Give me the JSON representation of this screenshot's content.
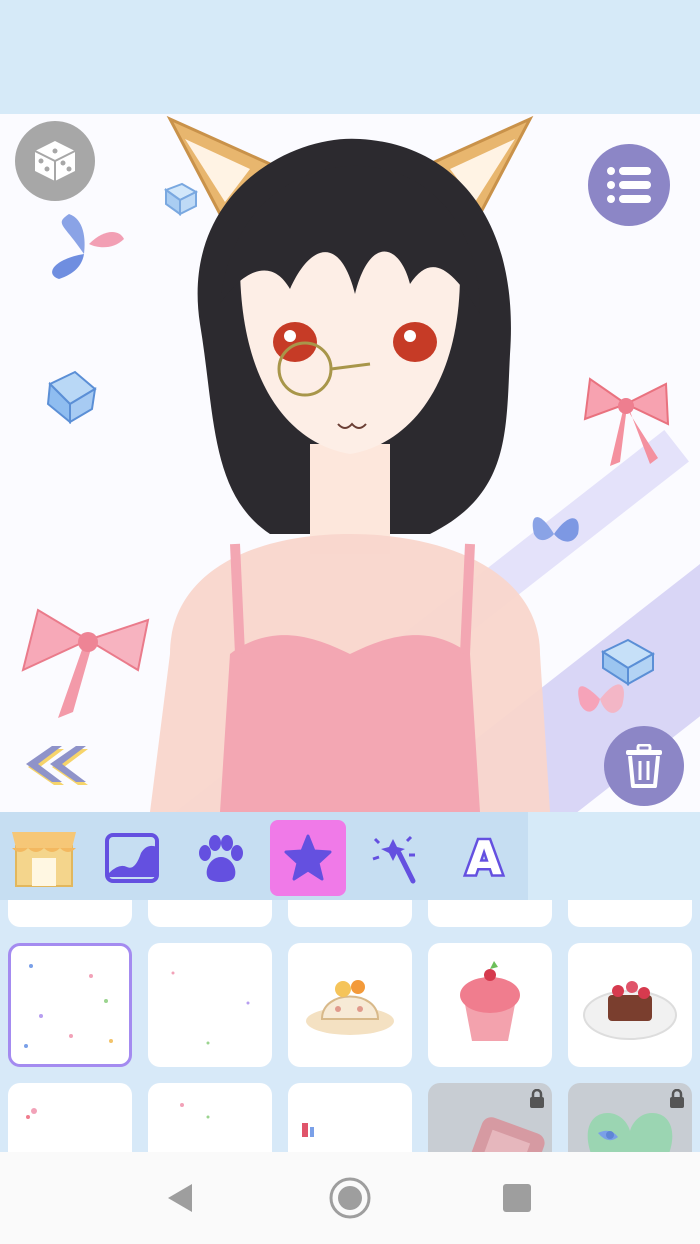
{
  "canvas": {
    "character": "cat-girl-avatar",
    "accent_color": "#8c86c6",
    "randomize_icon": "dice-icon",
    "menu_icon": "list-icon",
    "delete_icon": "trash-icon",
    "back_icon": "double-chevron-left-icon"
  },
  "toolbar": {
    "tabs": [
      {
        "icon": "shop-icon",
        "active": false
      },
      {
        "icon": "background-image-icon",
        "active": false
      },
      {
        "icon": "paw-icon",
        "active": false
      },
      {
        "icon": "star-icon",
        "active": true
      },
      {
        "icon": "magic-wand-icon",
        "active": false
      },
      {
        "icon": "text-icon",
        "active": false
      }
    ],
    "text_tab_label": "A",
    "active_color": "#f07ae8"
  },
  "items": {
    "selected_index": 0,
    "row2": [
      {
        "icon": "confetti-sparkles-item",
        "locked": false
      },
      {
        "icon": "tiny-sparkles-item",
        "locked": false
      },
      {
        "icon": "fruit-cake-item",
        "locked": false
      },
      {
        "icon": "berry-parfait-item",
        "locked": false
      },
      {
        "icon": "berry-dessert-plate-item",
        "locked": false
      }
    ],
    "row3": [
      {
        "icon": "ribbon-confetti-item",
        "locked": false
      },
      {
        "icon": "star-sparkles-item",
        "locked": false
      },
      {
        "icon": "tiny-ribbon-item",
        "locked": false
      },
      {
        "icon": "game-console-item",
        "locked": true
      },
      {
        "icon": "heart-box-item",
        "locked": true
      }
    ]
  },
  "navigation": {
    "back_icon": "triangle-back-icon",
    "home_icon": "circle-home-icon",
    "recents_icon": "square-recents-icon"
  }
}
